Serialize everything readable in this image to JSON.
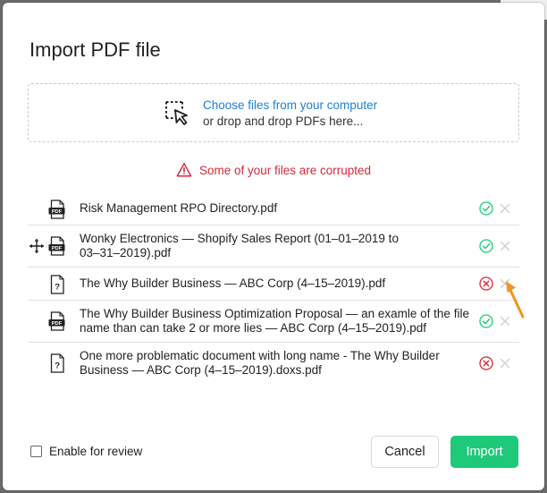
{
  "dialog": {
    "title": "Import PDF file",
    "dropzone": {
      "link_text": "Choose files from your computer",
      "subtext": "or drop and drop PDFs here..."
    },
    "alert": "Some of your files are corrupted",
    "files": [
      {
        "line1": "Risk Management RPO Directory.pdf",
        "line2": "",
        "type": "pdf-icon",
        "status": "ok",
        "movable": false
      },
      {
        "line1": "Wonky Electronics — Shopify Sales Report (01–01–2019 to",
        "line2": "03–31–2019).pdf",
        "type": "pdf-icon",
        "status": "ok",
        "movable": true
      },
      {
        "line1": "The Why Builder Business — ABC Corp (4–15–2019).pdf",
        "line2": "",
        "type": "unknown-file-icon",
        "status": "error",
        "movable": false
      },
      {
        "line1": "The Why Builder Business Optimization Proposal — an examle of the file",
        "line2": "name than can take 2 or more lies — ABC Corp (4–15–2019).pdf",
        "type": "pdf-icon",
        "status": "ok",
        "movable": false
      },
      {
        "line1": "One more problematic document with long name - The Why Builder",
        "line2": "Business — ABC Corp (4–15–2019).doxs.pdf",
        "type": "unknown-file-icon",
        "status": "error",
        "movable": false
      }
    ],
    "footer": {
      "checkbox_label": "Enable for review",
      "checkbox_checked": false,
      "cancel_label": "Cancel",
      "import_label": "Import"
    }
  },
  "icons": {
    "pdf_badge_text": "PDF",
    "unknown_badge_text": "?"
  },
  "colors": {
    "accent": "#1ec97a",
    "link": "#1f7fd6",
    "error": "#d62839",
    "success": "#1ec97a",
    "annotation_arrow": "#f0961e"
  }
}
